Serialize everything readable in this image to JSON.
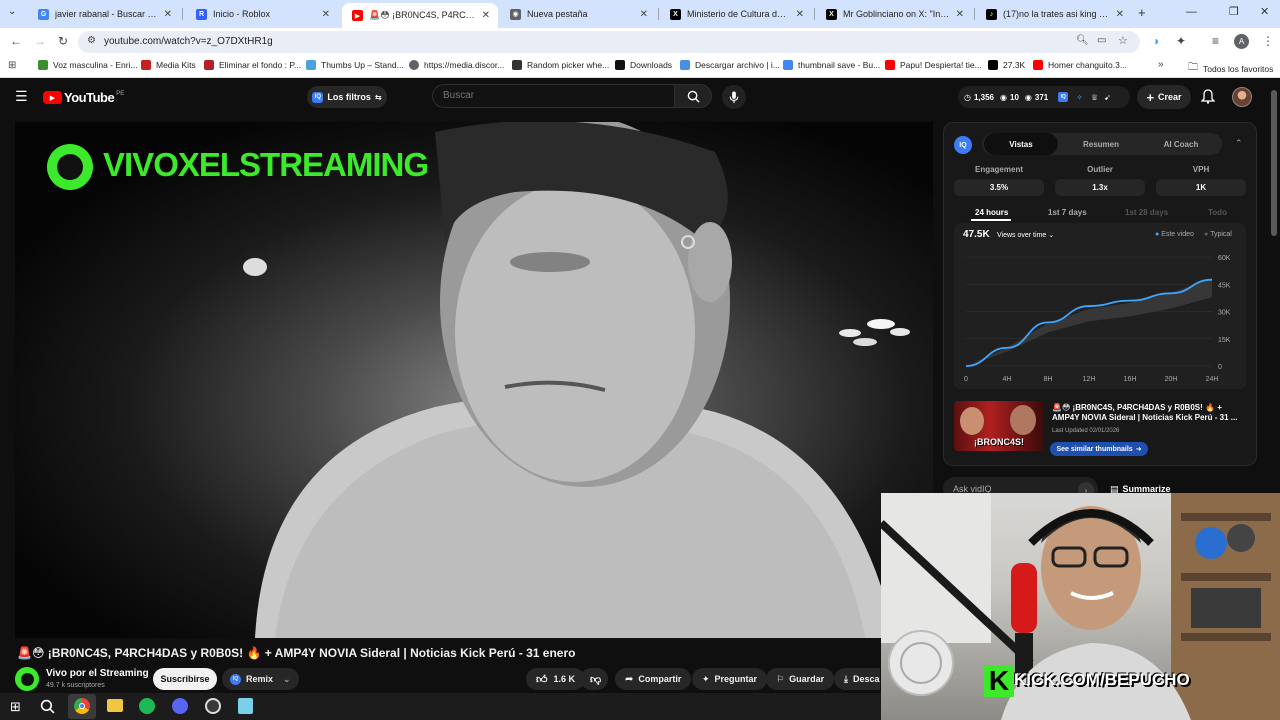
{
  "browser": {
    "tabs": [
      {
        "title": "javier rabanal - Buscar con Google",
        "icon_color": "#4285f4",
        "icon": "G"
      },
      {
        "title": "Inicio - Roblox",
        "icon_color": "#335fff",
        "icon": "R"
      },
      {
        "title": "🚨😳 ¡BR0NC4S, P4RCH4DAS y R0B0S!",
        "icon_color": "#ff0000",
        "icon": "▶"
      },
      {
        "title": "Nueva pestaña",
        "icon_color": "#5f6368",
        "icon": "◉"
      },
      {
        "title": "Ministerio de Cultura del Perú on X",
        "icon_color": "#000000",
        "icon": "X"
      },
      {
        "title": "Mr Goblinciano on X: \"Indignante",
        "icon_color": "#000000",
        "icon": "X"
      },
      {
        "title": "(17)no la trates asi king #milena",
        "icon_color": "#000000",
        "icon": "♪"
      }
    ],
    "url": "youtube.com/watch?v=z_O7DXtHR1g",
    "bookmarks": [
      {
        "label": "Voz masculina - Enri...",
        "color": "#3c8d2f"
      },
      {
        "label": "Media Kits",
        "color": "#c5221f"
      },
      {
        "label": "Eliminar el fondo : P...",
        "color": "#b3202a"
      },
      {
        "label": "Thumbs Up – Stand...",
        "color": "#4aa3df"
      },
      {
        "label": "https://media.discor...",
        "color": "#5f6368"
      },
      {
        "label": "Random picker whe...",
        "color": "#333333"
      },
      {
        "label": "Downloads",
        "color": "#111111"
      },
      {
        "label": "Descargar archivo | i...",
        "color": "#4a90e2"
      },
      {
        "label": "thumbnail save - Bu...",
        "color": "#4285f4"
      },
      {
        "label": "Papu! Despierta! tie...",
        "color": "#ff0000"
      },
      {
        "label": "27.3K",
        "color": "#000000"
      },
      {
        "label": "Homer changuito.3...",
        "color": "#ff0000"
      }
    ],
    "all_bookmarks": "Todos los favoritos"
  },
  "youtube": {
    "logo_text": "YouTube",
    "region": "PE",
    "filters_label": "Los filtros",
    "search_placeholder": "Buscar",
    "stats": {
      "a": "1,356",
      "b": "10",
      "c": "371"
    },
    "create_label": "Crear",
    "video_overlay_text": "VIVOXELSTREAMING",
    "title": "🚨😳 ¡BR0NC4S, P4RCH4DAS y R0B0S! 🔥 + AMP4Y NOVIA Sideral | Noticias Kick Perú - 31 enero",
    "channel_name": "Vivo por el Streaming",
    "subscribers": "49.7 k suscriptores",
    "subscribe_label": "Suscribirse",
    "remix_label": "Remix",
    "likes": "1.6 K",
    "share_label": "Compartir",
    "ask_label": "Preguntar",
    "save_label": "Guardar",
    "download_label": "Descargar"
  },
  "vidiq": {
    "tabs": [
      "Vistas",
      "Resumen",
      "AI Coach"
    ],
    "metrics": [
      {
        "label": "Engagement",
        "value": "3.5%"
      },
      {
        "label": "Outlier",
        "value": "1.3x"
      },
      {
        "label": "VPH",
        "value": "1K"
      }
    ],
    "ranges": [
      "24 hours",
      "1st 7 days",
      "1st 28 days",
      "Todo"
    ],
    "total_views": "47.5K",
    "dropdown_label": "Views over time",
    "legend_this": "Este video",
    "legend_typical": "Typical",
    "thumb_title": "🚨😳 ¡BR0NC4S, P4RCH4DAS y R0B0S! 🔥 + AMP4Y NOVIA Sideral | Noticias Kick Perú - 31 ...",
    "last_updated": "Last Updated 02/01/2026",
    "similar_label": "See similar thumbnails",
    "thumb_text": "¡BRONC4S!",
    "ask_label": "Ask vidIQ",
    "summarize_label": "Summarize"
  },
  "chart_data": {
    "type": "line",
    "x": [
      "0",
      "4H",
      "8H",
      "12H",
      "16H",
      "20H",
      "24H"
    ],
    "y_ticks": [
      "0",
      "15K",
      "30K",
      "45K",
      "60K"
    ],
    "ylim": [
      0,
      60000
    ],
    "series": [
      {
        "name": "Este video",
        "color": "#3ea6ff",
        "values": [
          0,
          10000,
          24000,
          33000,
          36000,
          40000,
          47500
        ]
      },
      {
        "name": "Typical",
        "color": "#606060",
        "values": [
          0,
          9000,
          21000,
          28000,
          31000,
          36000,
          43000
        ]
      }
    ]
  },
  "webcam": {
    "overlay_text": "KICK.COM/BEPUCHO",
    "kick_letter": "K"
  }
}
